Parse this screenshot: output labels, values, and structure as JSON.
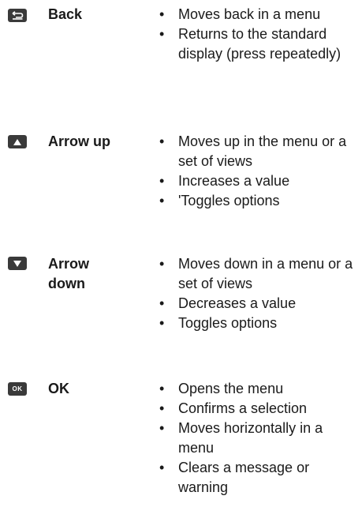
{
  "rows": [
    {
      "key": "Back",
      "icon": "back-key-icon",
      "items": [
        "Moves back in a menu",
        "Returns to the standard display (press repeatedly)"
      ]
    },
    {
      "key": "Arrow up",
      "icon": "arrow-up-key-icon",
      "items": [
        "Moves up in the menu or a set of views",
        "Increases a value",
        "'Toggles options"
      ]
    },
    {
      "key": "Arrow down",
      "icon": "arrow-down-key-icon",
      "items": [
        "Moves down in a menu or a set of views",
        "Decreases a value",
        "Toggles options"
      ]
    },
    {
      "key": "OK",
      "icon": "ok-key-icon",
      "icon_text": "OK",
      "items": [
        "Opens the menu",
        "Confirms a selection",
        "Moves horizontally in a menu",
        "Clears a message or warning"
      ]
    }
  ]
}
